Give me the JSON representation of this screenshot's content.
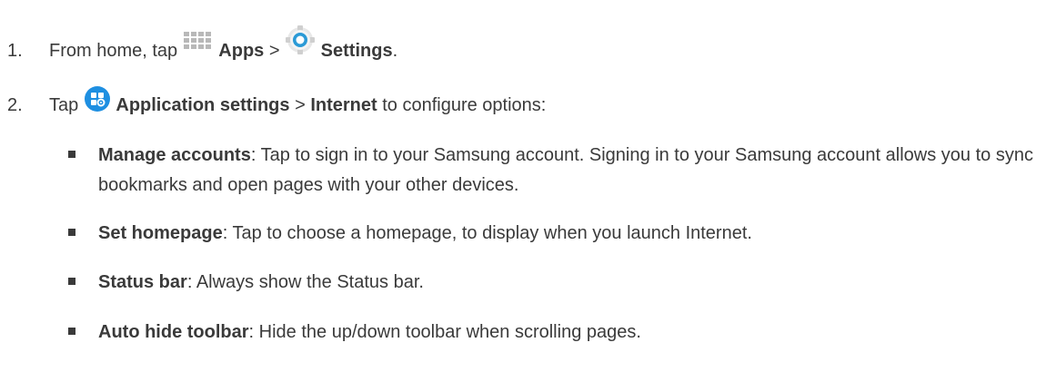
{
  "step1": {
    "number": "1.",
    "prefix": "From home, tap",
    "apps_label": "Apps",
    "separator": ">",
    "settings_label": "Settings",
    "end": "."
  },
  "step2": {
    "number": "2.",
    "prefix": "Tap",
    "app_settings_label": "Application settings",
    "separator": ">",
    "internet_label": "Internet",
    "suffix": "to configure options:"
  },
  "options": [
    {
      "term": "Manage accounts",
      "description": ": Tap to sign in to your Samsung account. Signing in to your Samsung account allows you to sync bookmarks and open pages with your other devices."
    },
    {
      "term": "Set homepage",
      "description": ": Tap to choose a homepage, to display when you launch Internet."
    },
    {
      "term": "Status bar",
      "description": ": Always show the Status bar."
    },
    {
      "term": "Auto hide toolbar",
      "description": ": Hide the up/down toolbar when scrolling pages."
    }
  ],
  "colors": {
    "text": "#3a3a3a",
    "apps_icon": "#b8b8b8",
    "settings_icon_ring": "#2b9ad6",
    "app_settings_icon": "#1e8fe1"
  },
  "icons": {
    "apps": "apps-grid-icon",
    "settings": "settings-gear-icon",
    "application_settings": "application-settings-icon"
  }
}
